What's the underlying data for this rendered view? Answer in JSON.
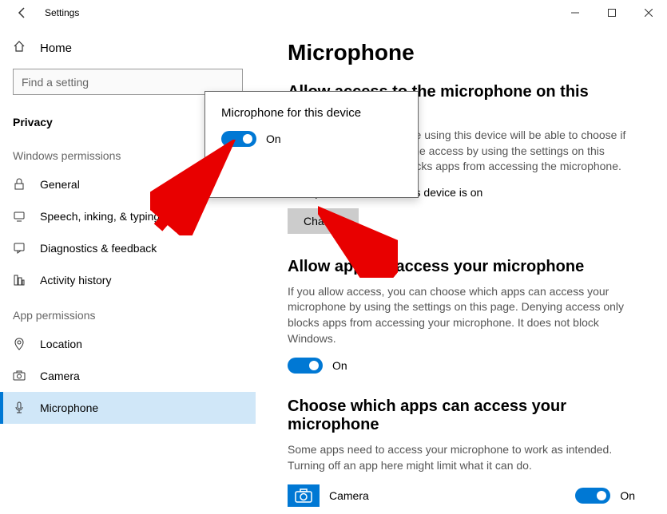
{
  "titlebar": {
    "title": "Settings"
  },
  "sidebar": {
    "home": "Home",
    "search_placeholder": "Find a setting",
    "section": "Privacy",
    "group1": "Windows permissions",
    "items1": [
      {
        "label": "General"
      },
      {
        "label": "Speech, inking, & typing"
      },
      {
        "label": "Diagnostics & feedback"
      },
      {
        "label": "Activity history"
      }
    ],
    "group2": "App permissions",
    "items2": [
      {
        "label": "Location"
      },
      {
        "label": "Camera"
      },
      {
        "label": "Microphone"
      }
    ]
  },
  "content": {
    "title": "Microphone",
    "sec1_h": "Allow access to the microphone on this device",
    "sec1_desc": "If you allow access, people using this device will be able to choose if their apps have microphone access by using the settings on this page. Denying access blocks apps from accessing the microphone.",
    "sec1_status": "Microphone access for this device is on",
    "change_btn": "Change",
    "sec2_h": "Allow apps to access your microphone",
    "sec2_desc": "If you allow access, you can choose which apps can access your microphone by using the settings on this page. Denying access only blocks apps from accessing your microphone. It does not block Windows.",
    "toggle_on": "On",
    "sec3_h": "Choose which apps can access your microphone",
    "sec3_desc": "Some apps need to access your microphone to work as intended. Turning off an app here might limit what it can do.",
    "app1_name": "Camera",
    "app1_state": "On"
  },
  "popup": {
    "title": "Microphone for this device",
    "state": "On"
  }
}
